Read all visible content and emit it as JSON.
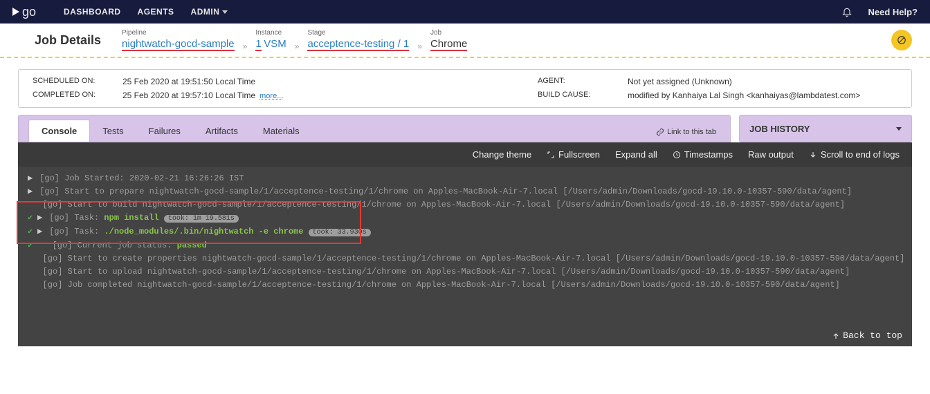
{
  "topbar": {
    "logo": "go",
    "nav": {
      "dashboard": "DASHBOARD",
      "agents": "AGENTS",
      "admin": "ADMIN"
    },
    "help": "Need Help?"
  },
  "header": {
    "title": "Job Details",
    "crumbs": {
      "pipeline_label": "Pipeline",
      "pipeline": "nightwatch-gocd-sample",
      "instance_label": "Instance",
      "instance": "1",
      "vsm": "VSM",
      "stage_label": "Stage",
      "stage": "acceptence-testing / 1",
      "job_label": "Job",
      "job": "Chrome"
    }
  },
  "meta": {
    "scheduled_label": "SCHEDULED ON:",
    "scheduled_val": "25 Feb 2020 at 19:51:50 Local Time",
    "completed_label": "COMPLETED ON:",
    "completed_val": "25 Feb 2020 at 19:57:10 Local Time",
    "more": "more...",
    "agent_label": "AGENT:",
    "agent_val": "Not yet assigned (Unknown)",
    "cause_label": "BUILD CAUSE:",
    "cause_val": "modified by Kanhaiya Lal Singh <kanhaiyas@lambdatest.com>"
  },
  "tabs": {
    "console": "Console",
    "tests": "Tests",
    "failures": "Failures",
    "artifacts": "Artifacts",
    "materials": "Materials",
    "link": "Link to this tab"
  },
  "history": {
    "title": "JOB HISTORY"
  },
  "toolbar": {
    "theme": "Change theme",
    "fullscreen": "Fullscreen",
    "expand": "Expand all",
    "timestamps": "Timestamps",
    "raw": "Raw output",
    "scroll": "Scroll to end of logs"
  },
  "console": {
    "l1": "[go] Job Started: 2020-02-21 16:26:26 IST",
    "l2": "[go] Start to prepare nightwatch-gocd-sample/1/acceptence-testing/1/chrome on Apples-MacBook-Air-7.local [/Users/admin/Downloads/gocd-19.10.0-10357-590/data/agent]",
    "l3": "[go] Start to build nightwatch-gocd-sample/1/acceptence-testing/1/chrome on Apples-MacBook-Air-7.local [/Users/admin/Downloads/gocd-19.10.0-10357-590/data/agent]",
    "l4_pre": "[go] Task: ",
    "l4_cmd": "npm install",
    "l4_took": "took: 1m 19.581s",
    "l5_pre": "[go] Task: ",
    "l5_cmd": "./node_modules/.bin/nightwatch -e chrome",
    "l5_took": "took: 33.930s",
    "l6_pre": "[go] Current job status: ",
    "l6_status": "passed",
    "l7": "[go] Start to create properties nightwatch-gocd-sample/1/acceptence-testing/1/chrome on Apples-MacBook-Air-7.local [/Users/admin/Downloads/gocd-19.10.0-10357-590/data/agent]",
    "l8": "[go] Start to upload nightwatch-gocd-sample/1/acceptence-testing/1/chrome on Apples-MacBook-Air-7.local [/Users/admin/Downloads/gocd-19.10.0-10357-590/data/agent]",
    "l9": "[go] Job completed nightwatch-gocd-sample/1/acceptence-testing/1/chrome on Apples-MacBook-Air-7.local [/Users/admin/Downloads/gocd-19.10.0-10357-590/data/agent]",
    "backtop": "Back to top"
  }
}
